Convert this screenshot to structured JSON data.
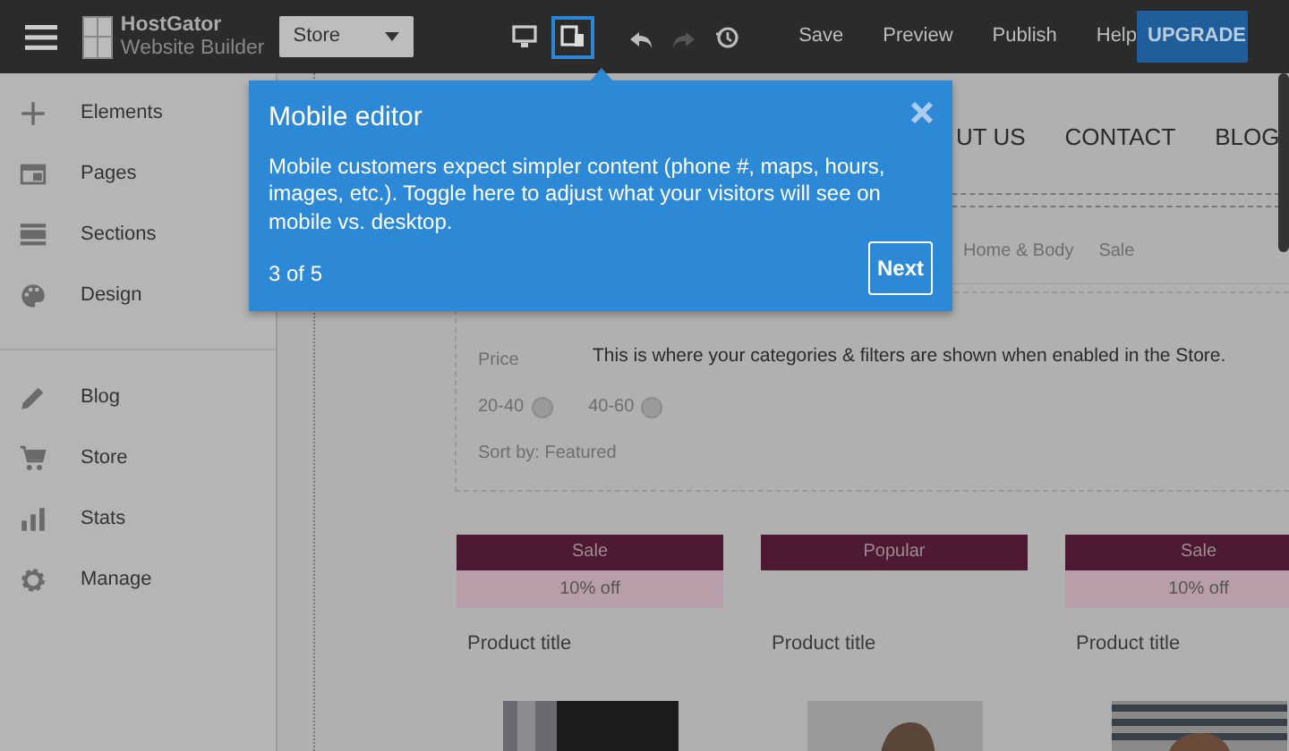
{
  "topbar": {
    "logo": {
      "line1": "HostGator",
      "line2": "Website Builder"
    },
    "page_select": {
      "value": "Store"
    },
    "view_toggles": [
      {
        "kind": "desktop",
        "selected": false
      },
      {
        "kind": "mobile",
        "selected": true
      }
    ],
    "history": [
      {
        "kind": "undo",
        "disabled": false
      },
      {
        "kind": "redo",
        "disabled": true
      },
      {
        "kind": "history",
        "disabled": false
      }
    ],
    "actions": [
      "Save",
      "Preview",
      "Publish",
      "Help"
    ],
    "upgrade": "UPGRADE"
  },
  "sidebar": {
    "groups": [
      [
        {
          "kind": "plus",
          "label": "Elements"
        },
        {
          "kind": "pages",
          "label": "Pages"
        },
        {
          "kind": "sections",
          "label": "Sections"
        },
        {
          "kind": "palette",
          "label": "Design"
        }
      ],
      [
        {
          "kind": "pencil",
          "label": "Blog"
        },
        {
          "kind": "cart",
          "label": "Store"
        },
        {
          "kind": "stats",
          "label": "Stats"
        },
        {
          "kind": "gear",
          "label": "Manage"
        }
      ]
    ]
  },
  "canvas": {
    "nav": [
      "UT US",
      "CONTACT",
      "BLOG"
    ],
    "categories": [
      "Home & Body",
      "Sale"
    ],
    "filters": {
      "price_label": "Price",
      "message": "This is where your categories & filters are shown when enabled in the Store.",
      "ranges": [
        "20-40",
        "40-60"
      ],
      "sort": "Sort by: Featured"
    },
    "products": [
      {
        "badge": "Sale",
        "discount": "10% off",
        "title": "Product title"
      },
      {
        "badge": "Popular",
        "title": "Product title"
      },
      {
        "badge": "Sale",
        "discount": "10% off",
        "title": "Product title"
      }
    ]
  },
  "tooltip": {
    "title": "Mobile editor",
    "body": "Mobile customers expect simpler content (phone #, maps, hours, images, etc.). Toggle here to adjust what your visitors will see on mobile vs. desktop.",
    "step": "3 of 5",
    "next": "Next"
  }
}
